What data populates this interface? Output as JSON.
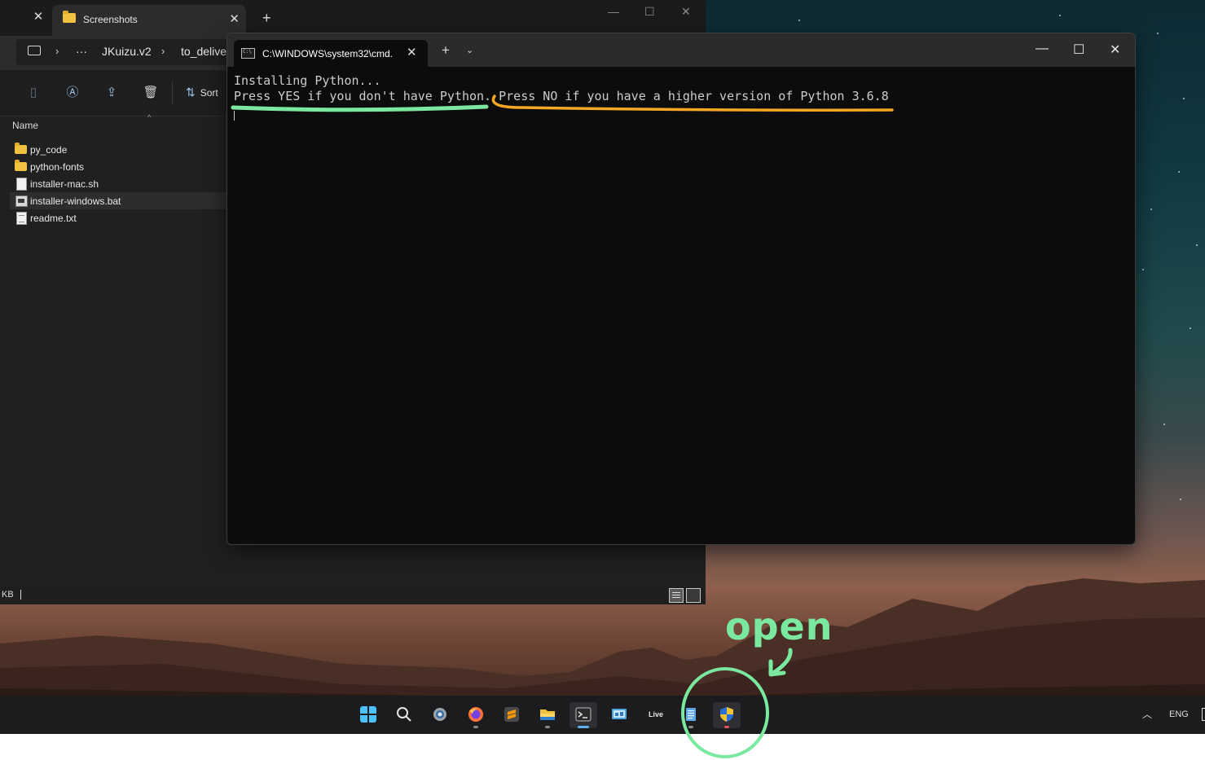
{
  "explorer": {
    "tab_title": "Screenshots",
    "breadcrumb": [
      "JKuizu.v2",
      "to_deliver"
    ],
    "breadcrumb_overflow": "···",
    "sort_label": "Sort",
    "column_header": "Name",
    "files": [
      {
        "name": "py_code",
        "type": "folder"
      },
      {
        "name": "python-fonts",
        "type": "folder"
      },
      {
        "name": "installer-mac.sh",
        "type": "file"
      },
      {
        "name": "installer-windows.bat",
        "type": "bat",
        "selected": true
      },
      {
        "name": "readme.txt",
        "type": "txt"
      }
    ],
    "status_text": "KB",
    "toolbar_icons": [
      "paste-icon",
      "rename-icon",
      "share-icon",
      "delete-icon"
    ]
  },
  "terminal": {
    "tab_title": "C:\\WINDOWS\\system32\\cmd.",
    "line1": "Installing Python...",
    "line2_part1": "Press YES if you don't have Python.",
    "line2_part2": " Press NO if you have a higher version of Python 3.6.8"
  },
  "taskbar": {
    "apps": [
      "start-icon",
      "search-icon",
      "settings-icon",
      "firefox-icon",
      "sublime-text-icon",
      "file-explorer-icon",
      "terminal-icon",
      "control-panel-icon",
      "live-icon",
      "notepad-icon",
      "uac-shield-icon"
    ],
    "live_label": "Live",
    "tray_lang": "ENG"
  },
  "annotation": {
    "label": "open",
    "green": "#7be8a0",
    "orange": "#f5a623"
  }
}
